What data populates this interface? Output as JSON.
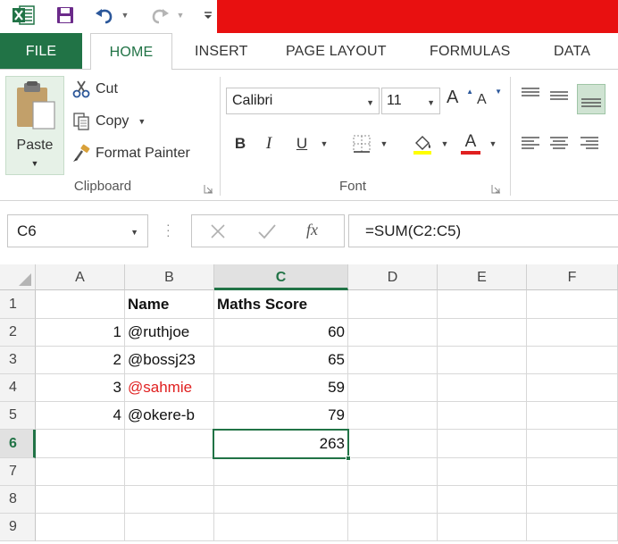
{
  "app": {
    "title_bar_color": "#e81010",
    "brand_color": "#217346"
  },
  "quick_access": {
    "icons": [
      "excel-logo-icon",
      "save-icon",
      "undo-icon",
      "redo-icon",
      "customize-icon"
    ]
  },
  "tabs": [
    {
      "label": "FILE"
    },
    {
      "label": "HOME",
      "active": true
    },
    {
      "label": "INSERT"
    },
    {
      "label": "PAGE LAYOUT"
    },
    {
      "label": "FORMULAS"
    },
    {
      "label": "DATA"
    }
  ],
  "clipboard": {
    "paste_label": "Paste",
    "cut_label": "Cut",
    "copy_label": "Copy",
    "format_painter_label": "Format Painter",
    "group_label": "Clipboard"
  },
  "font": {
    "name": "Calibri",
    "size": "11",
    "bold": "B",
    "italic": "I",
    "underline": "U",
    "grow": "A",
    "shrink": "A",
    "font_color_glyph": "A",
    "font_color": "#e02020",
    "group_label": "Font"
  },
  "formula_bar": {
    "name_box": "C6",
    "fx": "fx",
    "formula": "=SUM(C2:C5)"
  },
  "sheet": {
    "columns": [
      "A",
      "B",
      "C",
      "D",
      "E",
      "F"
    ],
    "active_column": "C",
    "rows": [
      "1",
      "2",
      "3",
      "4",
      "5",
      "6",
      "7",
      "8",
      "9"
    ],
    "active_row": "6",
    "header_row": {
      "b": "Name",
      "c": "Maths Score"
    },
    "data_rows": [
      {
        "a": "1",
        "b": "@ruthjoe",
        "c": "60"
      },
      {
        "a": "2",
        "b": "@bossj23",
        "c": "65"
      },
      {
        "a": "3",
        "b": "@sahmie",
        "c": "59",
        "b_color": "#e02020"
      },
      {
        "a": "4",
        "b": "@okere-b",
        "c": "79"
      }
    ],
    "total": {
      "c": "263"
    },
    "selected_cell": "C6"
  }
}
